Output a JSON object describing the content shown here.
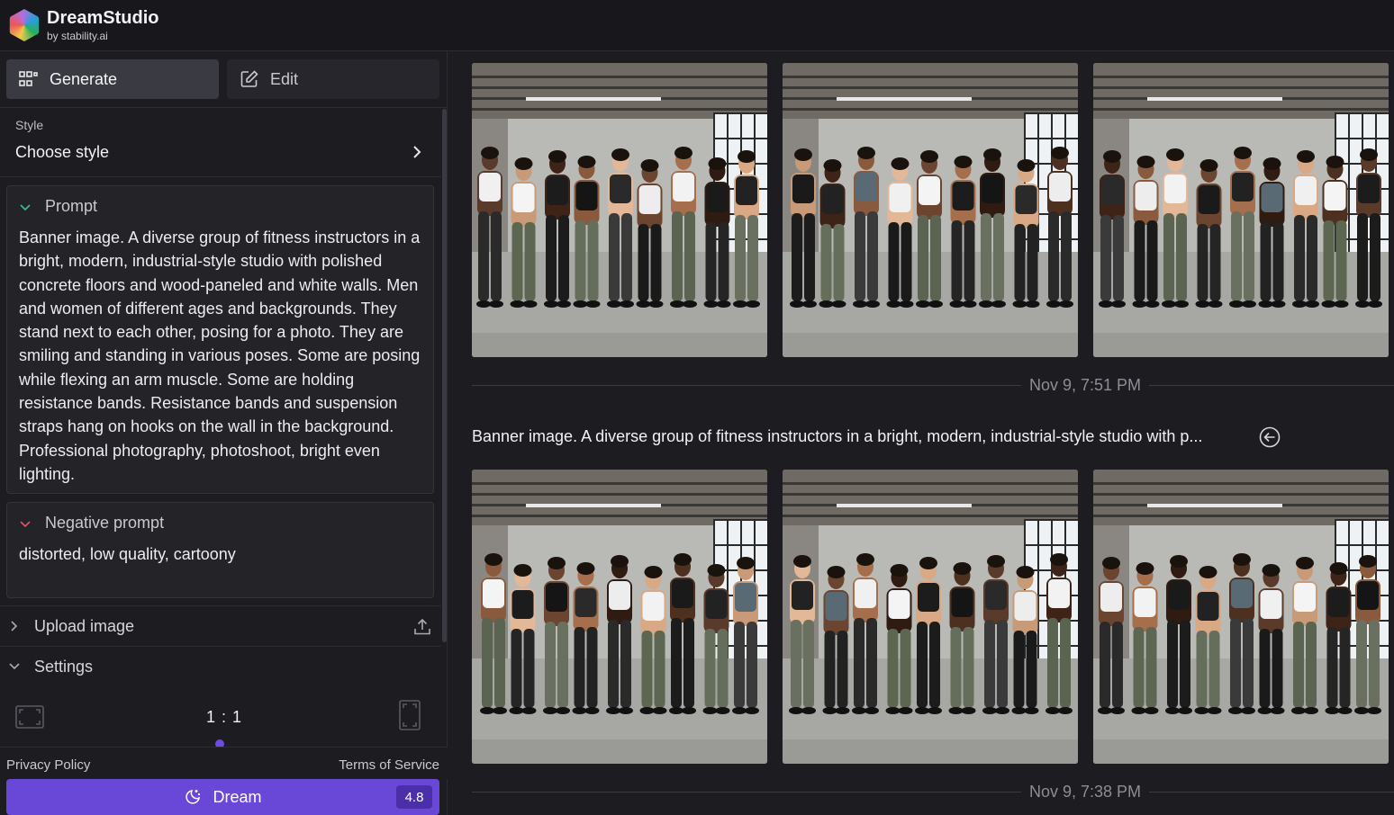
{
  "header": {
    "title": "DreamStudio",
    "subtitle": "by stability.ai",
    "logo_icon": "dreamstudio-logo"
  },
  "tabs": [
    {
      "label": "Generate",
      "icon": "grid-icon",
      "active": true
    },
    {
      "label": "Edit",
      "icon": "edit-icon",
      "active": false
    }
  ],
  "style": {
    "label": "Style",
    "value": "Choose style"
  },
  "prompt": {
    "label": "Prompt",
    "text": "Banner image. A diverse group of fitness instructors in a bright, modern, industrial-style studio with polished concrete floors and wood-paneled and white walls. Men and women of different ages and backgrounds. They stand next to each other, posing for a photo. They are smiling and standing in various poses. Some are posing while flexing an arm muscle. Some are holding resistance bands. Resistance bands and suspension straps hang on hooks on the wall in the background. Professional photography, photoshoot, bright even lighting."
  },
  "negative_prompt": {
    "label": "Negative prompt",
    "text": "distorted, low quality, cartoony"
  },
  "upload": {
    "label": "Upload image"
  },
  "settings": {
    "label": "Settings",
    "aspect_ratio": "1 : 1"
  },
  "footer": {
    "privacy": "Privacy Policy",
    "terms": "Terms of Service"
  },
  "dream_button": {
    "label": "Dream",
    "credits": "4.8"
  },
  "gallery": {
    "groups": [
      {
        "timestamp": "Nov 9, 7:51 PM",
        "prompt": "Banner image. A diverse group of fitness instructors in a bright, modern, industrial-style studio with p..."
      },
      {
        "timestamp": "Nov 9, 7:38 PM"
      }
    ],
    "image_alt": "Group of fitness instructors in industrial studio"
  },
  "colors": {
    "accent": "#6a48d7",
    "background": "#1c1c21",
    "panel": "#232328"
  }
}
